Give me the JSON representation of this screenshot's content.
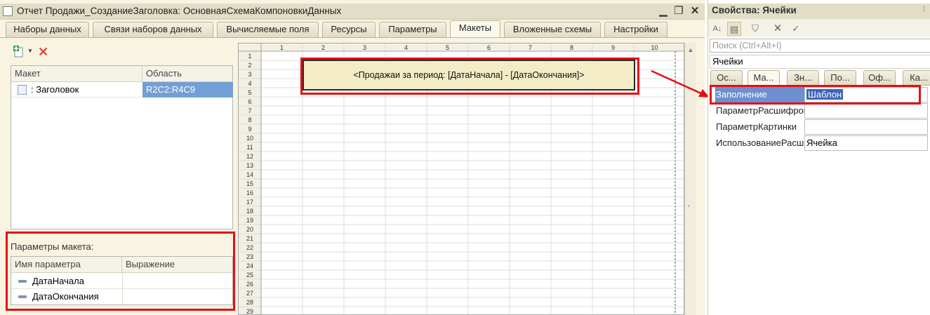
{
  "window": {
    "title": "Отчет Продажи_СозданиеЗаголовка: ОсновнаяСхемаКомпоновкиДанных"
  },
  "tabs": [
    {
      "label": "Наборы данных"
    },
    {
      "label": "Связи наборов данных"
    },
    {
      "label": "Вычисляемые поля"
    },
    {
      "label": "Ресурсы"
    },
    {
      "label": "Параметры"
    },
    {
      "label": "Макеты",
      "active": true
    },
    {
      "label": "Вложенные схемы"
    },
    {
      "label": "Настройки"
    }
  ],
  "makets": {
    "columns": [
      "Макет",
      "Область"
    ],
    "rows": [
      {
        "name": ": Заголовок",
        "area": "R2C2:R4C9"
      }
    ]
  },
  "params": {
    "label": "Параметры макета:",
    "columns": [
      "Имя параметра",
      "Выражение"
    ],
    "rows": [
      {
        "name": "ДатаНачала",
        "expr": ""
      },
      {
        "name": "ДатаОкончания",
        "expr": ""
      }
    ]
  },
  "sheet": {
    "col_labels": [
      "1",
      "2",
      "3",
      "4",
      "5",
      "6",
      "7",
      "8",
      "9",
      "10"
    ],
    "row_count": 29,
    "header_cell_text": "<Продажаи за период: [ДатаНачала] - [ДатаОкончания]>"
  },
  "properties": {
    "title": "Свойства: Ячейки",
    "search_placeholder": "Поиск (Ctrl+Alt+I)",
    "object_name": "Ячейки",
    "tabs": [
      "Ос...",
      "Ма...",
      "Зн...",
      "По...",
      "Оф...",
      "Ка..."
    ],
    "active_tab": 1,
    "rows": [
      {
        "name": "Заполнение",
        "value": "Шаблон",
        "selected": true
      },
      {
        "name": "ПараметрРасшифровки",
        "value": ""
      },
      {
        "name": "ПараметрКартинки",
        "value": ""
      },
      {
        "name": "ИспользованиеРасшифровки",
        "value": "Ячейка"
      }
    ]
  },
  "colors": {
    "highlight_red": "#e50e15",
    "selection_blue": "#729fd6",
    "panel_bg": "#f8f4e1"
  }
}
